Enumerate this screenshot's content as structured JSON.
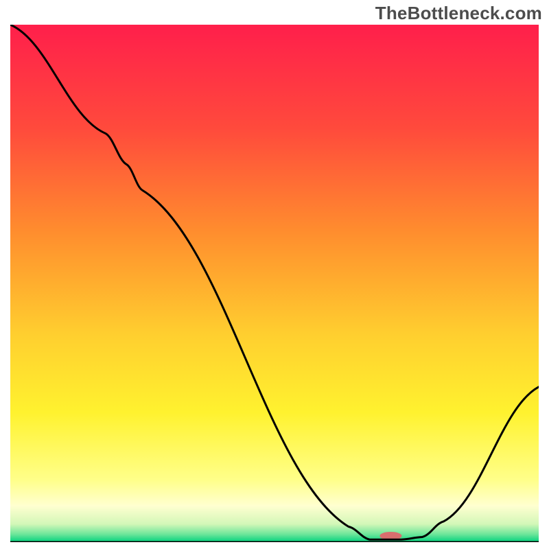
{
  "watermark": "TheBottleneck.com",
  "chart_data": {
    "type": "line",
    "title": "",
    "xlabel": "",
    "ylabel": "",
    "xlim": [
      0,
      100
    ],
    "ylim": [
      0,
      100
    ],
    "gradient_stops": [
      {
        "offset": 0.0,
        "color": "#ff1f4b"
      },
      {
        "offset": 0.2,
        "color": "#ff4a3c"
      },
      {
        "offset": 0.4,
        "color": "#ff8d2e"
      },
      {
        "offset": 0.6,
        "color": "#ffcf2f"
      },
      {
        "offset": 0.75,
        "color": "#fff22f"
      },
      {
        "offset": 0.88,
        "color": "#ffff8a"
      },
      {
        "offset": 0.93,
        "color": "#ffffd0"
      },
      {
        "offset": 0.965,
        "color": "#d3f7b8"
      },
      {
        "offset": 0.985,
        "color": "#6be69a"
      },
      {
        "offset": 1.0,
        "color": "#00d07c"
      }
    ],
    "curve": [
      {
        "x": 0,
        "y": 100
      },
      {
        "x": 18,
        "y": 79
      },
      {
        "x": 22,
        "y": 73
      },
      {
        "x": 25,
        "y": 68
      },
      {
        "x": 64,
        "y": 3
      },
      {
        "x": 68,
        "y": 0.5
      },
      {
        "x": 74,
        "y": 0.5
      },
      {
        "x": 78,
        "y": 1
      },
      {
        "x": 82,
        "y": 4
      },
      {
        "x": 100,
        "y": 30
      }
    ],
    "marker": {
      "x": 72,
      "y": 1.2,
      "color": "#d96e6e",
      "rx": 16,
      "ry": 6
    }
  }
}
